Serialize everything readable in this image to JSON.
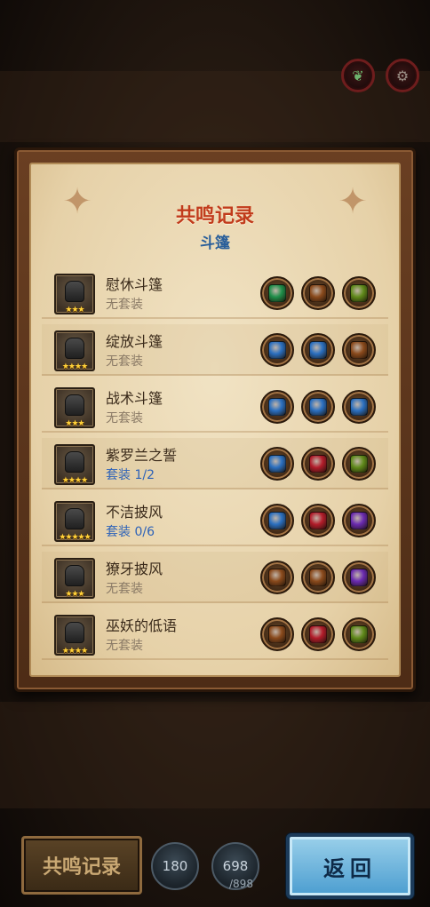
{
  "header": {
    "icon_left": "dragon-icon",
    "icon_right": "gear-icon"
  },
  "panel": {
    "title": "共鸣记录",
    "subtitle": "斗篷"
  },
  "gem_colors": {
    "green": "#1f8f4a",
    "brown": "#8a4a1c",
    "olive": "#5f8a1a",
    "blue": "#2a6fc0",
    "red": "#b21c2a",
    "purple": "#6a2ab0"
  },
  "items": [
    {
      "name": "慰休斗篷",
      "set": "无套装",
      "set_active": false,
      "stars": "★★★",
      "gems": [
        "green",
        "brown",
        "olive"
      ]
    },
    {
      "name": "绽放斗篷",
      "set": "无套装",
      "set_active": false,
      "stars": "★★★★",
      "gems": [
        "blue",
        "blue",
        "brown"
      ]
    },
    {
      "name": "战术斗篷",
      "set": "无套装",
      "set_active": false,
      "stars": "★★★",
      "gems": [
        "blue",
        "blue",
        "blue"
      ]
    },
    {
      "name": "紫罗兰之誓",
      "set": "套装 1/2",
      "set_active": true,
      "stars": "★★★★",
      "gems": [
        "blue",
        "red",
        "olive"
      ]
    },
    {
      "name": "不洁披风",
      "set": "套装 0/6",
      "set_active": true,
      "stars": "★★★★★",
      "gems": [
        "blue",
        "red",
        "purple"
      ]
    },
    {
      "name": "獠牙披风",
      "set": "无套装",
      "set_active": false,
      "stars": "★★★",
      "gems": [
        "brown",
        "brown",
        "purple"
      ]
    },
    {
      "name": "巫妖的低语",
      "set": "无套装",
      "set_active": false,
      "stars": "★★★★",
      "gems": [
        "brown",
        "red",
        "olive"
      ]
    }
  ],
  "footer": {
    "resonance_button": "共鸣记录",
    "badge1_value": "180",
    "badge2_value": "698",
    "badge2_max": "/898",
    "return_button": "返回"
  }
}
